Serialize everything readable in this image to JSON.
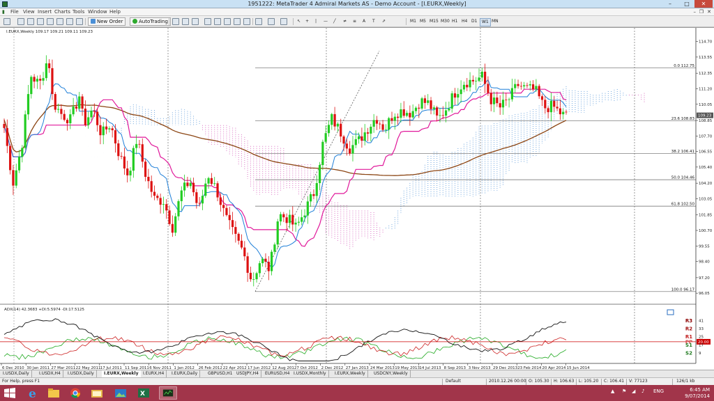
{
  "window": {
    "title": "1951222: MetaTrader 4 Admiral Markets AS - Demo Account - [I.EURX,Weekly]"
  },
  "menu": {
    "items": [
      "File",
      "View",
      "Insert",
      "Charts",
      "Tools",
      "Window",
      "Help"
    ]
  },
  "toolbar": {
    "new_order_label": "New Order",
    "autotrading_label": "AutoTrading",
    "timeframes": [
      "M1",
      "M5",
      "M15",
      "M30",
      "H1",
      "H4",
      "D1",
      "W1",
      "MN"
    ],
    "active_timeframe": "W1"
  },
  "chart": {
    "info_line": "I.EURX,Weekly  109.17 109.21 109.11 109.23",
    "current_price": "109.23",
    "adx_info": "ADX(14) 42.3683 +DI:5.5974 -DI:17.5125",
    "colors": {
      "bull": "#22cc22",
      "bear": "#dd1111",
      "sma": "#8b4513",
      "kijun": "#e0189a",
      "tenkan": "#1e7fd8",
      "cloud_bear": "#d24fb5",
      "cloud_bull": "#4a8fd6"
    }
  },
  "chart_data": {
    "type": "candlestick",
    "price_axis": {
      "ticks": [
        "114.70",
        "113.55",
        "112.35",
        "111.20",
        "110.05",
        "108.85",
        "107.70",
        "106.55",
        "105.40",
        "104.20",
        "103.05",
        "101.85",
        "100.70",
        "99.55",
        "98.40",
        "97.20",
        "96.05"
      ],
      "ylim": [
        95.8,
        115.3
      ]
    },
    "date_labels": [
      "6 Dec 2010",
      "30 Jan 2011",
      "27 Mar 2011",
      "22 May 2011",
      "17 Jul 2011",
      "11 Sep 2011",
      "6 Nov 2011",
      "1 Jan 2012",
      "26 Feb 2012",
      "22 Apr 2012",
      "17 Jun 2012",
      "12 Aug 2012",
      "7 Oct 2012",
      "2 Dec 2012",
      "27 Jan 2013",
      "24 Mar 2013",
      "19 May 2013",
      "14 Jul 2013",
      "8 Sep 2013",
      "3 Nov 2013",
      "29 Dec 2013",
      "23 Feb 2014",
      "20 Apr 2014",
      "15 Jun 2014"
    ],
    "fib_levels": [
      {
        "label": "0.0",
        "value": 112.75
      },
      {
        "label": "23.6",
        "value": 108.83
      },
      {
        "label": "38.2",
        "value": 106.41
      },
      {
        "label": "50.0",
        "value": 104.46
      },
      {
        "label": "61.8",
        "value": 102.5
      },
      {
        "label": "100.0",
        "value": 96.17
      }
    ],
    "price_path": [
      [
        0,
        108.3
      ],
      [
        2,
        104.2
      ],
      [
        4,
        107.0
      ],
      [
        6,
        112.2
      ],
      [
        8,
        111.5
      ],
      [
        10,
        113.6
      ],
      [
        11,
        110.2
      ],
      [
        13,
        109.3
      ],
      [
        15,
        108.9
      ],
      [
        17,
        110.7
      ],
      [
        18,
        108.6
      ],
      [
        20,
        109.7
      ],
      [
        22,
        107.8
      ],
      [
        24,
        108.6
      ],
      [
        26,
        106.3
      ],
      [
        28,
        104.8
      ],
      [
        30,
        107.5
      ],
      [
        32,
        104.8
      ],
      [
        34,
        103.0
      ],
      [
        36,
        102.9
      ],
      [
        38,
        100.9
      ],
      [
        40,
        103.5
      ],
      [
        42,
        104.4
      ],
      [
        44,
        102.2
      ],
      [
        46,
        104.9
      ],
      [
        48,
        103.7
      ],
      [
        50,
        101.7
      ],
      [
        52,
        100.3
      ],
      [
        54,
        99.1
      ],
      [
        56,
        96.9
      ],
      [
        58,
        98.6
      ],
      [
        60,
        97.8
      ],
      [
        62,
        101.9
      ],
      [
        64,
        101.6
      ],
      [
        66,
        100.9
      ],
      [
        68,
        102.2
      ],
      [
        70,
        103.5
      ],
      [
        72,
        107.1
      ],
      [
        74,
        109.0
      ],
      [
        76,
        108.0
      ],
      [
        78,
        106.8
      ],
      [
        80,
        107.3
      ],
      [
        82,
        108.2
      ],
      [
        84,
        109.1
      ],
      [
        86,
        108.2
      ],
      [
        88,
        109.4
      ],
      [
        90,
        109.6
      ],
      [
        92,
        109.4
      ],
      [
        94,
        110.3
      ],
      [
        96,
        110.1
      ],
      [
        98,
        108.9
      ],
      [
        100,
        109.8
      ],
      [
        102,
        111.0
      ],
      [
        104,
        111.7
      ],
      [
        106,
        111.8
      ],
      [
        108,
        112.1
      ],
      [
        110,
        110.4
      ],
      [
        112,
        109.8
      ],
      [
        114,
        110.4
      ],
      [
        116,
        111.5
      ],
      [
        118,
        111.2
      ],
      [
        120,
        111.1
      ],
      [
        122,
        109.8
      ],
      [
        124,
        109.9
      ],
      [
        126,
        109.3
      ],
      [
        127,
        109.2
      ]
    ],
    "adx_levels": {
      "labels": [
        "R3",
        "R2",
        "R1",
        "PP",
        "S1",
        "S2"
      ],
      "ticks": [
        "41",
        "33",
        "25",
        "20.00",
        "17",
        "9"
      ],
      "pp_value": "20.00"
    }
  },
  "tabs": {
    "items": [
      "I.USDX,Daily",
      "I.USDX,H4",
      "I.USDX,Daily",
      "I.EURX,Weekly",
      "I.EURX,H4",
      "I.EURX,Daily",
      "GBPUSD,H1",
      "USDJPY,H4",
      "EURUSD,H4",
      "I.USDX,Monthly",
      "I.EURX,Weekly",
      "USDCNY,Weekly"
    ],
    "active_index": 3
  },
  "status": {
    "help": "For Help, press F1",
    "profile": "Default",
    "datetime": "2010.12.26 00:00",
    "open": "O: 105.30",
    "high": "H: 106.63",
    "low": "L: 105.20",
    "close": "C: 106.41",
    "volume": "V: 77123",
    "traffic": "126/1 kb"
  },
  "taskbar": {
    "lang": "ENG",
    "time": "6:45 AM",
    "date": "9/07/2014"
  }
}
